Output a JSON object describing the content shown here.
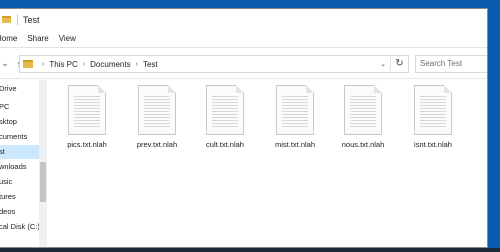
{
  "window": {
    "title": "Test"
  },
  "ribbon": {
    "tabs": [
      "Home",
      "Share",
      "View"
    ]
  },
  "address": {
    "crumbs": [
      "This PC",
      "Documents",
      "Test"
    ],
    "search_placeholder": "Search Test"
  },
  "sidebar": {
    "items": [
      "Drive",
      "PC",
      "sktop",
      "cuments",
      "st",
      "wnloads",
      "usic",
      "tures",
      "deos",
      "cal Disk (C:)"
    ],
    "selected_index": 4
  },
  "files": [
    {
      "name": "pics.txt.nlah"
    },
    {
      "name": "prev.txt.nlah"
    },
    {
      "name": "cult.txt.nlah"
    },
    {
      "name": "mist.txt.nlah"
    },
    {
      "name": "nous.txt.nlah"
    },
    {
      "name": "isnt.txt.nlah"
    }
  ],
  "colors": {
    "desktop": "#0a5cb0",
    "selection": "#cce8ff",
    "folder": "#e9b94a"
  }
}
